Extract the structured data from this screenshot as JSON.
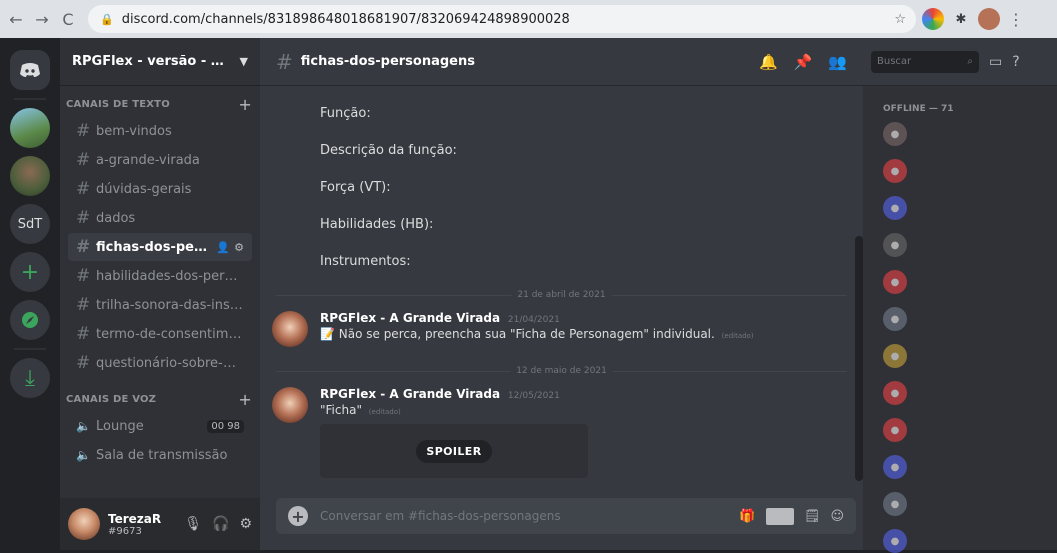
{
  "browser": {
    "url": "discord.com/channels/831898648018681907/832069424898900028"
  },
  "guilds": [
    {
      "label": ""
    },
    {
      "label": ""
    },
    {
      "label": ""
    },
    {
      "label": "SdT"
    }
  ],
  "server": {
    "name": "RPGFlex - versão - A Gra..."
  },
  "categories": {
    "text": "CANAIS DE TEXTO",
    "voice": "CANAIS DE VOZ"
  },
  "text_channels": [
    {
      "label": "bem-vindos"
    },
    {
      "label": "a-grande-virada"
    },
    {
      "label": "dúvidas-gerais"
    },
    {
      "label": "dados"
    },
    {
      "label": "fichas-dos-persona..."
    },
    {
      "label": "habilidades-dos-persona..."
    },
    {
      "label": "trilha-sonora-das-inspira..."
    },
    {
      "label": "termo-de-consentimento..."
    },
    {
      "label": "questionário-sobre-o-jogo"
    }
  ],
  "voice_channels": [
    {
      "label": "Lounge",
      "counter": "00 98"
    },
    {
      "label": "Sala de transmissão"
    }
  ],
  "user": {
    "name": "TerezaR",
    "tag": "#9673"
  },
  "channel": {
    "title": "fichas-dos-personagens"
  },
  "search": {
    "placeholder": "Buscar"
  },
  "form_fields": [
    "Função:",
    "Descrição da função:",
    "Força (VT):",
    "Habilidades (HB):",
    "Instrumentos:"
  ],
  "dividers": [
    "21 de abril de 2021",
    "12 de maio de 2021"
  ],
  "messages": [
    {
      "author": "RPGFlex - A Grande Virada",
      "timestamp": "21/04/2021",
      "text": "📝 Não se perca, preencha sua \"Ficha de Personagem\" individual.",
      "edited": "(editado)"
    },
    {
      "author": "RPGFlex - A Grande Virada",
      "timestamp": "12/05/2021",
      "text": "\"Ficha\"",
      "edited": "(editado)"
    }
  ],
  "spoiler_label": "SPOILER",
  "composer": {
    "placeholder": "Conversar em #fichas-dos-personagens",
    "gif": "GIF"
  },
  "members": {
    "category": "OFFLINE — 71",
    "colors": [
      "#7d6a6a",
      "#ed4245",
      "#5865f2",
      "#6b6b6b",
      "#ed4245",
      "#747f8d",
      "#caa53a",
      "#ed4245",
      "#ed4245",
      "#5865f2",
      "#747f8d",
      "#5865f2"
    ]
  }
}
